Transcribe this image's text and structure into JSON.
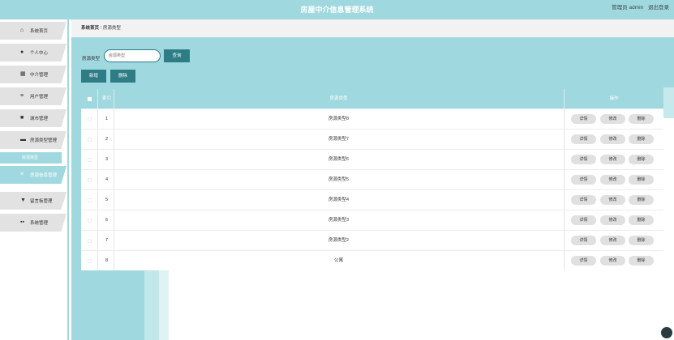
{
  "header": {
    "title": "房屋中介信息管理系统",
    "user_label": "管理员 admin",
    "logout_label": "退出登录"
  },
  "sidebar": {
    "items": [
      {
        "label": "系统首页",
        "icon": "home-icon"
      },
      {
        "label": "个人中心",
        "icon": "user-icon"
      },
      {
        "label": "中介管理",
        "icon": "building-icon"
      },
      {
        "label": "用户管理",
        "icon": "list-icon"
      },
      {
        "label": "城市管理",
        "icon": "box-icon"
      },
      {
        "label": "房源类型管理",
        "icon": "briefcase-icon"
      },
      {
        "label": "房源信息管理",
        "icon": "list-icon"
      },
      {
        "label": "留言板管理",
        "icon": "trophy-icon"
      },
      {
        "label": "系统管理",
        "icon": "grid-icon"
      }
    ],
    "submenu_label": "房源类型"
  },
  "breadcrumb": {
    "home": "系统首页",
    "separator": "⁝",
    "current": "房源类型"
  },
  "search": {
    "label": "房源类型",
    "placeholder": "房源类型",
    "value": "",
    "button": "查询"
  },
  "actions": {
    "add": "新增",
    "delete": "删除"
  },
  "table": {
    "headers": {
      "index": "索引",
      "type": "房源类型",
      "ops": "操作"
    },
    "rows": [
      {
        "index": "1",
        "name": "房源类型8"
      },
      {
        "index": "2",
        "name": "房源类型7"
      },
      {
        "index": "3",
        "name": "房源类型6"
      },
      {
        "index": "4",
        "name": "房源类型5"
      },
      {
        "index": "5",
        "name": "房源类型4"
      },
      {
        "index": "6",
        "name": "房源类型3"
      },
      {
        "index": "7",
        "name": "房源类型2"
      },
      {
        "index": "8",
        "name": "公寓"
      }
    ],
    "row_buttons": {
      "detail": "详情",
      "edit": "修改",
      "delete": "删除"
    }
  },
  "colors": {
    "accent": "#a0d8df",
    "button_dark": "#2e7c85",
    "menu_bg": "#e2e2e2"
  }
}
